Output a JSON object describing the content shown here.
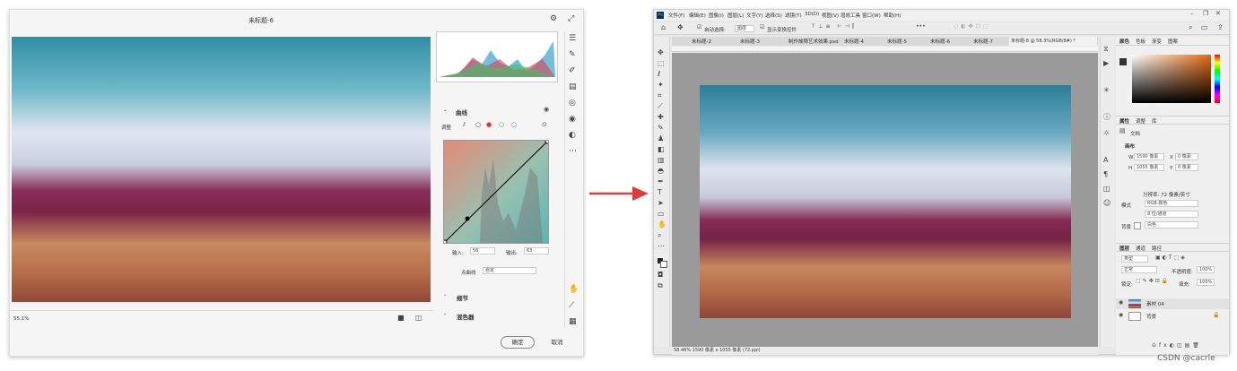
{
  "left": {
    "title": "未标题-6",
    "zoom": "55.1%",
    "curves": {
      "header": "曲线",
      "adjust_label": "调整",
      "input_label": "输入:",
      "input_value": "56",
      "output_label": "输出:",
      "output_value": "63",
      "pointcurve_label": "点曲线",
      "pointcurve_value": "自定"
    },
    "details_header": "细节",
    "mixer_header": "混色器",
    "confirm": "确定",
    "cancel": "取消"
  },
  "right": {
    "menus": [
      "文件(F)",
      "编辑(E)",
      "图像(I)",
      "图层(L)",
      "文字(Y)",
      "选择(S)",
      "滤镜(T)",
      "3D(D)",
      "视图(V)",
      "增效工具",
      "窗口(W)",
      "帮助(H)"
    ],
    "options": {
      "auto_select": "自动选择:",
      "layer_select": "图层",
      "show_transform": "显示变换控件"
    },
    "tabs": [
      "未标题-2",
      "未标题-3",
      "制作故障艺术效果.psd",
      "未标题-4",
      "未标题-5",
      "未标题-6",
      "未标题-7",
      "未标题-8 @ 58.3%(RGB/8#) *"
    ],
    "color_tabs": [
      "颜色",
      "色板",
      "渐变",
      "图案"
    ],
    "props_tabs": [
      "属性",
      "调整",
      "库"
    ],
    "doc_label": "文档",
    "canvas_label": "画布",
    "w_label": "W",
    "w_value": "1590 像素",
    "h_label": "H",
    "h_value": "1055 像素",
    "x_label": "X",
    "x_value": "0 像素",
    "y_label": "Y",
    "y_value": "0 像素",
    "resolution": "分辨率: 72 像素/英寸",
    "mode_label": "模式",
    "mode_value": "RGB 颜色",
    "depth_value": "8 位/通道",
    "bg_label": "背景",
    "bg_value": "白色",
    "layers_tabs": [
      "图层",
      "通道",
      "路径"
    ],
    "layer_kind": "类型",
    "blend_mode": "正常",
    "opacity_label": "不透明度:",
    "opacity_value": "100%",
    "lock_label": "锁定:",
    "fill_label": "填充:",
    "fill_value": "100%",
    "layers": [
      "素材 04",
      "背景"
    ],
    "status": "58.46%   1590 像素 x 1055 像素 (72 ppi)"
  },
  "watermark": "CSDN @cacrle"
}
